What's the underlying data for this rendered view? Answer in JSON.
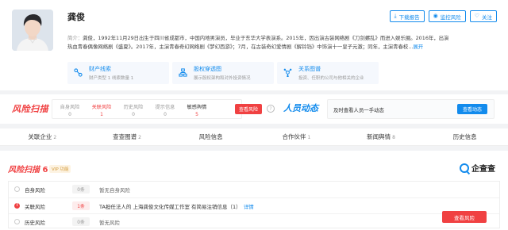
{
  "profile": {
    "name": "龚俊",
    "buttons": {
      "download": "下载报告",
      "monitor": "监控风险",
      "follow": "关注"
    },
    "bio_label": "简介：",
    "bio_line1": "龚俊，1992年11月29日出生于四川省成都市，中国内地男演员，毕业于东华大学表演系。2015年，因出演古装网络剧《刀剑螺乱》而进入娱乐圈。2016年，出演",
    "bio_line2": "热血青春偶像网络剧《盛夏》。2017年，主演青春奇幻网络剧《梦幻西游》；7月，在古装奇幻爱情剧《解铃铛》中饰演十一皇子元澈；同年，主演青春校...",
    "bio_more": "展开",
    "cards": [
      {
        "icon": "wealth-icon",
        "title": "财产线索",
        "sub": "财产类型 1 线索数量 1"
      },
      {
        "icon": "equity-chart-icon",
        "title": "股权穿透图",
        "sub": "展示股权架构和对外投资情况"
      },
      {
        "icon": "relation-map-icon",
        "title": "关系图谱",
        "sub": "投资、任职的公司与他相关的企业"
      }
    ]
  },
  "risk_scan": {
    "logo": "风险扫描",
    "items": [
      {
        "label": "自身风险",
        "value": "0"
      },
      {
        "label": "关联风险",
        "value": "1"
      },
      {
        "label": "历史风险",
        "value": "0"
      },
      {
        "label": "提示信息",
        "value": "0"
      },
      {
        "label": "敏感舆情",
        "value": "5"
      }
    ],
    "check_button": "查看风险"
  },
  "person_news": {
    "logo": "人员动态",
    "text": "及时查看人员一手动态",
    "button": "查看动态"
  },
  "tabs": [
    {
      "label": "关联企业",
      "count": "2"
    },
    {
      "label": "查查图谱",
      "count": "2"
    },
    {
      "label": "风险信息",
      "count": ""
    },
    {
      "label": "合作伙伴",
      "count": "1"
    },
    {
      "label": "新闻舆情",
      "count": "8"
    },
    {
      "label": "历史信息",
      "count": ""
    }
  ],
  "section": {
    "title": "风险扫描",
    "count": "6",
    "vip": "VIP 功能",
    "brand": "企查查",
    "rows": [
      {
        "name": "自身风险",
        "pill": "0条",
        "desc": "暂无自身风险",
        "link": ""
      },
      {
        "name": "关联风险",
        "pill": "1条",
        "desc": "TA担任法人的 上海龚俊文化传媒工作室 有简易注销信息（1）",
        "link": "详情"
      },
      {
        "name": "历史风险",
        "pill": "0条",
        "desc": "暂无风险",
        "link": ""
      }
    ],
    "check_button": "查看风险"
  },
  "colors": {
    "accent_blue": "#128bed",
    "risk_red": "#f04142"
  }
}
